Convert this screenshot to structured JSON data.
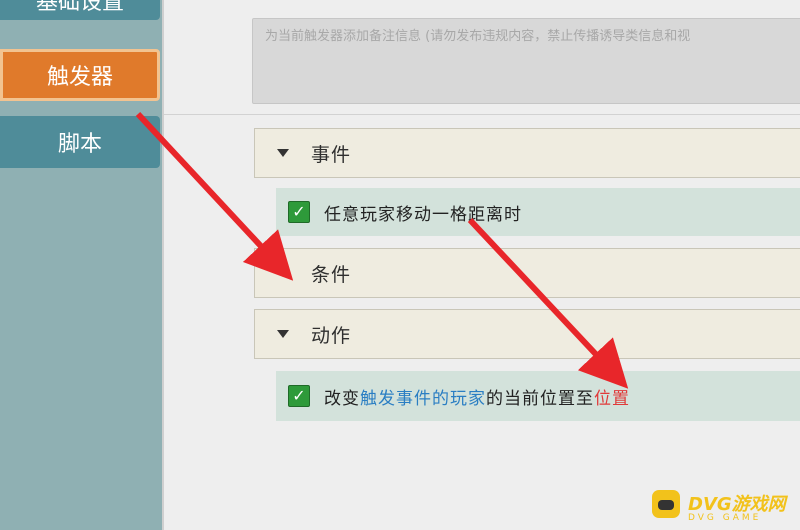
{
  "sidebar": {
    "items": [
      {
        "label": "基础设置"
      },
      {
        "label": "触发器"
      },
      {
        "label": "脚本"
      }
    ]
  },
  "note": {
    "placeholder": "为当前触发器添加备注信息 (请勿发布违规内容，禁止传播诱导类信息和视"
  },
  "sections": {
    "event": {
      "label": "事件",
      "item": "任意玩家移动一格距离时"
    },
    "condition": {
      "label": "条件"
    },
    "action": {
      "label": "动作",
      "item": {
        "part1": "改变",
        "link1": "触发事件的玩家",
        "part2": "的当前位置至",
        "link2": "位置"
      }
    }
  },
  "watermark": {
    "title": "DVG游戏网",
    "sub": "DVG GAME"
  },
  "colors": {
    "accent_orange": "#e07a2b",
    "sidebar_teal": "#4f8c99",
    "link_blue": "#2a7ec3",
    "highlight_red": "#e03a3a",
    "arrow_red": "#e8262a"
  }
}
